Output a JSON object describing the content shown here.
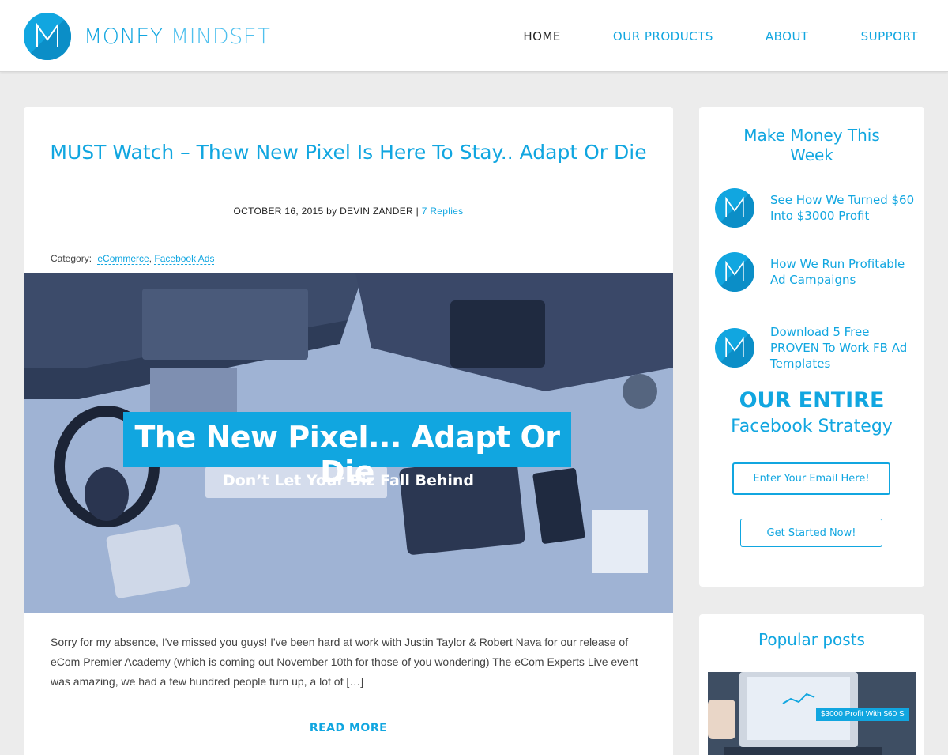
{
  "header": {
    "brand_main": "MONEY",
    "brand_light": "MINDSET",
    "nav": [
      {
        "label": "HOME",
        "active": true
      },
      {
        "label": "OUR PRODUCTS",
        "active": false
      },
      {
        "label": "ABOUT",
        "active": false
      },
      {
        "label": "SUPPORT",
        "active": false
      }
    ]
  },
  "post": {
    "title": "MUST Watch – Thew New Pixel Is Here To Stay.. Adapt Or Die",
    "date": "OCTOBER 16, 2015",
    "by": "by",
    "author": "DEVIN ZANDER",
    "separator": "|",
    "replies": "7 Replies",
    "category_label": "Category:",
    "categories": [
      "eCommerce",
      "Facebook Ads"
    ],
    "image_title": "The New Pixel... Adapt Or Die",
    "image_subtitle": "Don’t Let Your Biz Fall Behind",
    "excerpt": "Sorry for my absence, I've missed you guys! I've been hard at work with Justin Taylor & Robert Nava for our release of eCom Premier Academy (which is coming out November 10th for those of you wondering) The eCom Experts Live event was amazing, we had a few hundred people turn up, a lot of […]",
    "read_more": "READ MORE"
  },
  "sidebar": {
    "widget_title": "Make Money This Week",
    "items": [
      {
        "label": "See How We Turned $60 Into $3000 Profit",
        "icon": "money-mindset-logo-icon"
      },
      {
        "label": "How We Run Profitable Ad Campaigns",
        "icon": "money-mindset-logo-icon"
      },
      {
        "label": "Download 5 Free PROVEN To Work FB Ad Templates",
        "icon": "money-mindset-logo-icon"
      }
    ],
    "optin_heading": "OUR ENTIRE",
    "optin_subheading": "Facebook Strategy",
    "email_placeholder": "Enter Your Email Here!",
    "cta_label": "Get Started Now!",
    "popular_title": "Popular posts",
    "popular_caption": "$3000 Profit With $60 S"
  },
  "colors": {
    "accent": "#11a6e0",
    "background": "#ececec",
    "hero_tint": "#8aa2c7"
  }
}
